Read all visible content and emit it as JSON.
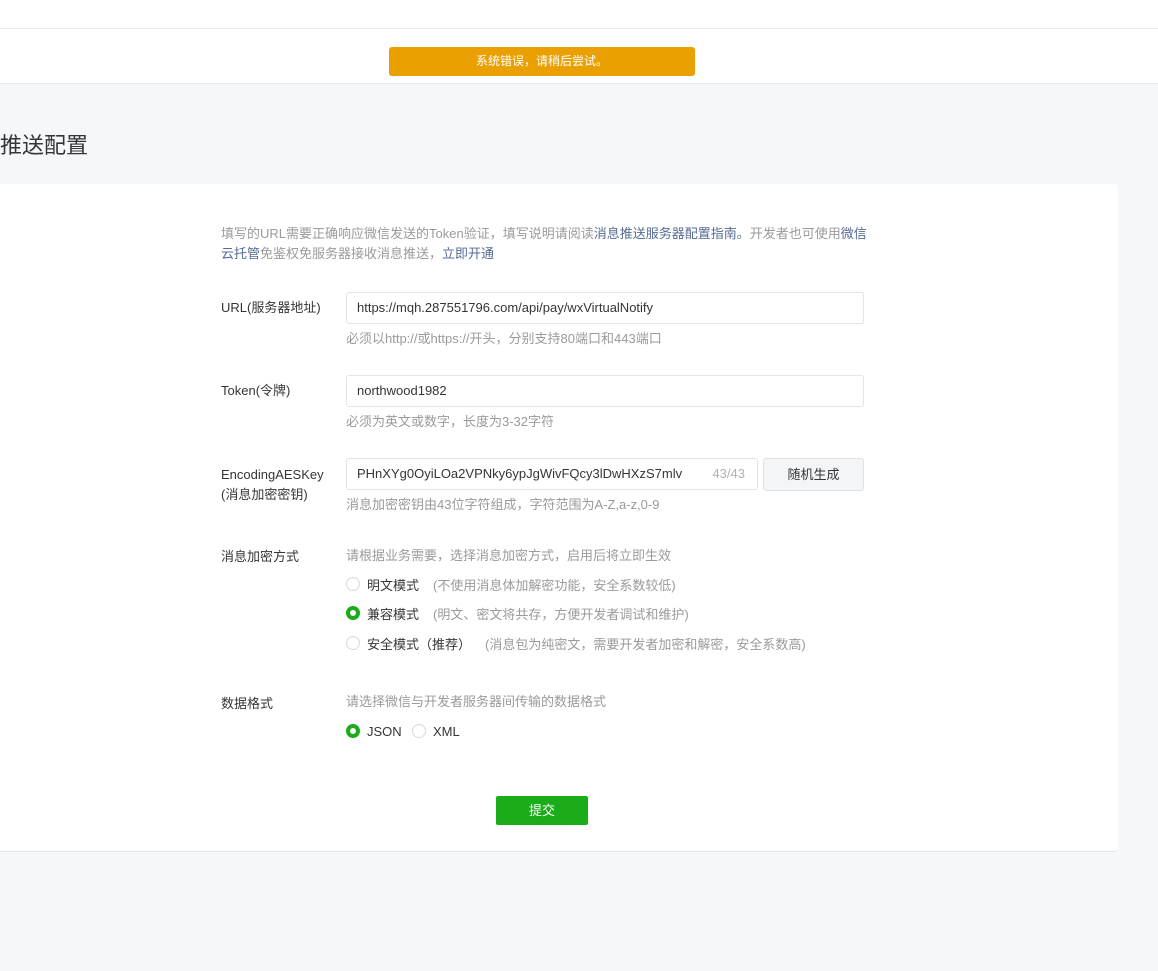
{
  "toast": {
    "message": "系统错误，请稍后尝试。"
  },
  "page": {
    "title": "息推送配置"
  },
  "intro": {
    "text_1": "填写的URL需要正确响应微信发送的Token验证，填写说明请阅读",
    "link_guide": "消息推送服务器配置指南。",
    "text_2": "开发者也可使用",
    "link_cloud": "微信云托管",
    "text_3": "免鉴权免服务器接收消息推送，",
    "link_enable": "立即开通"
  },
  "form": {
    "url": {
      "label": "URL(服务器地址)",
      "value": "https://mqh.287551796.com/api/pay/wxVirtualNotify",
      "hint": "必须以http://或https://开头，分别支持80端口和443端口"
    },
    "token": {
      "label": "Token(令牌)",
      "value": "northwood1982",
      "hint": "必须为英文或数字，长度为3-32字符"
    },
    "aes": {
      "label_1": "EncodingAESKey",
      "label_2": "(消息加密密钥)",
      "value": "PHnXYg0OyiLOa2VPNky6ypJgWivFQcy3lDwHXzS7mlv",
      "counter": "43/43",
      "generate_label": "随机生成",
      "hint": "消息加密密钥由43位字符组成，字符范围为A-Z,a-z,0-9"
    },
    "encryption": {
      "label": "消息加密方式",
      "hint": "请根据业务需要，选择消息加密方式，启用后将立即生效",
      "options": [
        {
          "label": "明文模式",
          "desc": "(不使用消息体加解密功能，安全系数较低)",
          "checked": false
        },
        {
          "label": "兼容模式",
          "desc": "(明文、密文将共存，方便开发者调试和维护)",
          "checked": true
        },
        {
          "label": "安全模式（推荐）",
          "desc": "(消息包为纯密文，需要开发者加密和解密，安全系数高)",
          "checked": false
        }
      ]
    },
    "format": {
      "label": "数据格式",
      "hint": "请选择微信与开发者服务器间传输的数据格式",
      "options": [
        {
          "label": "JSON",
          "checked": true
        },
        {
          "label": "XML",
          "checked": false
        }
      ]
    },
    "submit_label": "提交"
  },
  "colors": {
    "accent": "#1aad19",
    "warning": "#eaa000",
    "link": "#576b95"
  }
}
